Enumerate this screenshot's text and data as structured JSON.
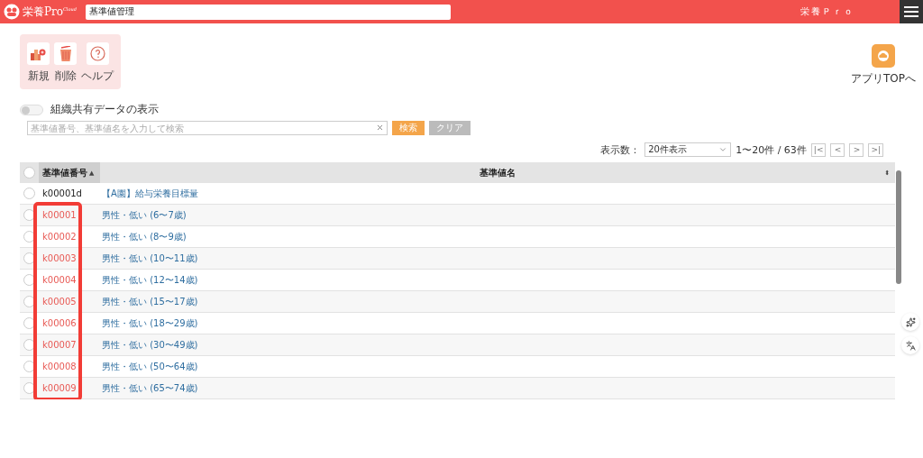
{
  "header": {
    "logo": "栄養Pro",
    "logo_sup": "Cloud",
    "search_value": "基準値管理",
    "user": "栄養Ｐｒｏ"
  },
  "toolbar": [
    {
      "label": "新規",
      "kind": "new"
    },
    {
      "label": "削除",
      "kind": "delete"
    },
    {
      "label": "ヘルプ",
      "kind": "help"
    }
  ],
  "app_top": {
    "label": "アプリTOPへ"
  },
  "shared_toggle": {
    "label": "組織共有データの表示",
    "on": false
  },
  "search": {
    "placeholder": "基準値番号、基準値名を入力して検索",
    "buttons": [
      {
        "label": "検索",
        "kind": "primary"
      },
      {
        "label": "クリア",
        "kind": "secondary"
      }
    ]
  },
  "pager": {
    "label": "表示数：",
    "page_size": "20件表示",
    "range": "1〜20件 / 63件",
    "buttons": [
      "|<",
      "<",
      ">",
      ">|"
    ]
  },
  "table": {
    "all_selected": false,
    "columns": [
      {
        "label": "基準値番号",
        "sort_mark": "▲",
        "selected": true
      },
      {
        "label": "基準値名",
        "sort_mark": "⬍",
        "selected": false
      }
    ],
    "rows": [
      {
        "code": "k00001d",
        "name": "【A園】給与栄養目標量",
        "selected": false,
        "highlighted": false
      },
      {
        "code": "k00001",
        "name": "男性・低い (6〜7歳)",
        "selected": false,
        "highlighted": true
      },
      {
        "code": "k00002",
        "name": "男性・低い (8〜9歳)",
        "selected": false,
        "highlighted": true
      },
      {
        "code": "k00003",
        "name": "男性・低い (10〜11歳)",
        "selected": false,
        "highlighted": true
      },
      {
        "code": "k00004",
        "name": "男性・低い (12〜14歳)",
        "selected": false,
        "highlighted": true
      },
      {
        "code": "k00005",
        "name": "男性・低い (15〜17歳)",
        "selected": false,
        "highlighted": true
      },
      {
        "code": "k00006",
        "name": "男性・低い (18〜29歳)",
        "selected": false,
        "highlighted": true
      },
      {
        "code": "k00007",
        "name": "男性・低い (30〜49歳)",
        "selected": false,
        "highlighted": true
      },
      {
        "code": "k00008",
        "name": "男性・低い (50〜64歳)",
        "selected": false,
        "highlighted": true
      },
      {
        "code": "k00009",
        "name": "男性・低い (65〜74歳)",
        "selected": false,
        "highlighted": true
      }
    ]
  }
}
